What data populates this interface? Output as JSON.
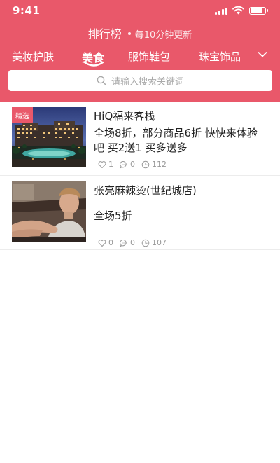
{
  "status_bar": {
    "time": "9:41"
  },
  "header": {
    "title": "排行榜",
    "subtitle": "每10分钟更新"
  },
  "tabs": [
    {
      "label": "美妆护肤",
      "active": false
    },
    {
      "label": "美食",
      "active": true
    },
    {
      "label": "服饰鞋包",
      "active": false
    },
    {
      "label": "珠宝饰品",
      "active": false
    }
  ],
  "search": {
    "placeholder": "请输入搜索关键词"
  },
  "items": [
    {
      "tag": "精选",
      "title": "HiQ福来客栈",
      "description": "全场8折，部分商品6折 快快来体验吧 买2送1 买多送多",
      "likes": "1",
      "comments": "0",
      "views": "112"
    },
    {
      "tag": "",
      "title": "张亮麻辣烫(世纪城店)",
      "description": "全场5折",
      "likes": "0",
      "comments": "0",
      "views": "107"
    }
  ],
  "colors": {
    "brand": "#e9586a",
    "muted": "#999999"
  }
}
